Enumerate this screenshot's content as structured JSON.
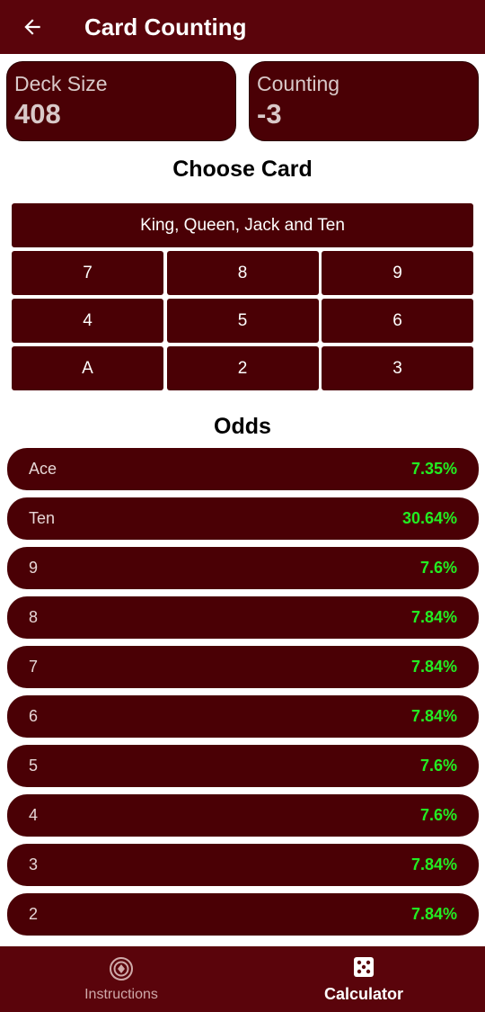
{
  "appbar": {
    "title": "Card Counting",
    "back_icon": "arrow-left-icon"
  },
  "stats": {
    "deck_size": {
      "label": "Deck Size",
      "value": "408"
    },
    "counting": {
      "label": "Counting",
      "value": "-3"
    }
  },
  "picker": {
    "title": "Choose Card",
    "wide_label": "King, Queen, Jack and Ten",
    "rows": [
      [
        "7",
        "8",
        "9"
      ],
      [
        "4",
        "5",
        "6"
      ],
      [
        "A",
        "2",
        "3"
      ]
    ]
  },
  "odds": {
    "title": "Odds",
    "items": [
      {
        "label": "Ace",
        "value": "7.35%"
      },
      {
        "label": "Ten",
        "value": "30.64%"
      },
      {
        "label": "9",
        "value": "7.6%"
      },
      {
        "label": "8",
        "value": "7.84%"
      },
      {
        "label": "7",
        "value": "7.84%"
      },
      {
        "label": "6",
        "value": "7.84%"
      },
      {
        "label": "5",
        "value": "7.6%"
      },
      {
        "label": "4",
        "value": "7.6%"
      },
      {
        "label": "3",
        "value": "7.84%"
      },
      {
        "label": "2",
        "value": "7.84%"
      }
    ]
  },
  "bottomnav": {
    "items": [
      {
        "label": "Instructions",
        "icon": "target-icon",
        "active": false
      },
      {
        "label": "Calculator",
        "icon": "dice-icon",
        "active": true
      }
    ]
  },
  "colors": {
    "primary": "#5a040b",
    "card": "#4a0005",
    "odds_value": "#22ee22"
  }
}
